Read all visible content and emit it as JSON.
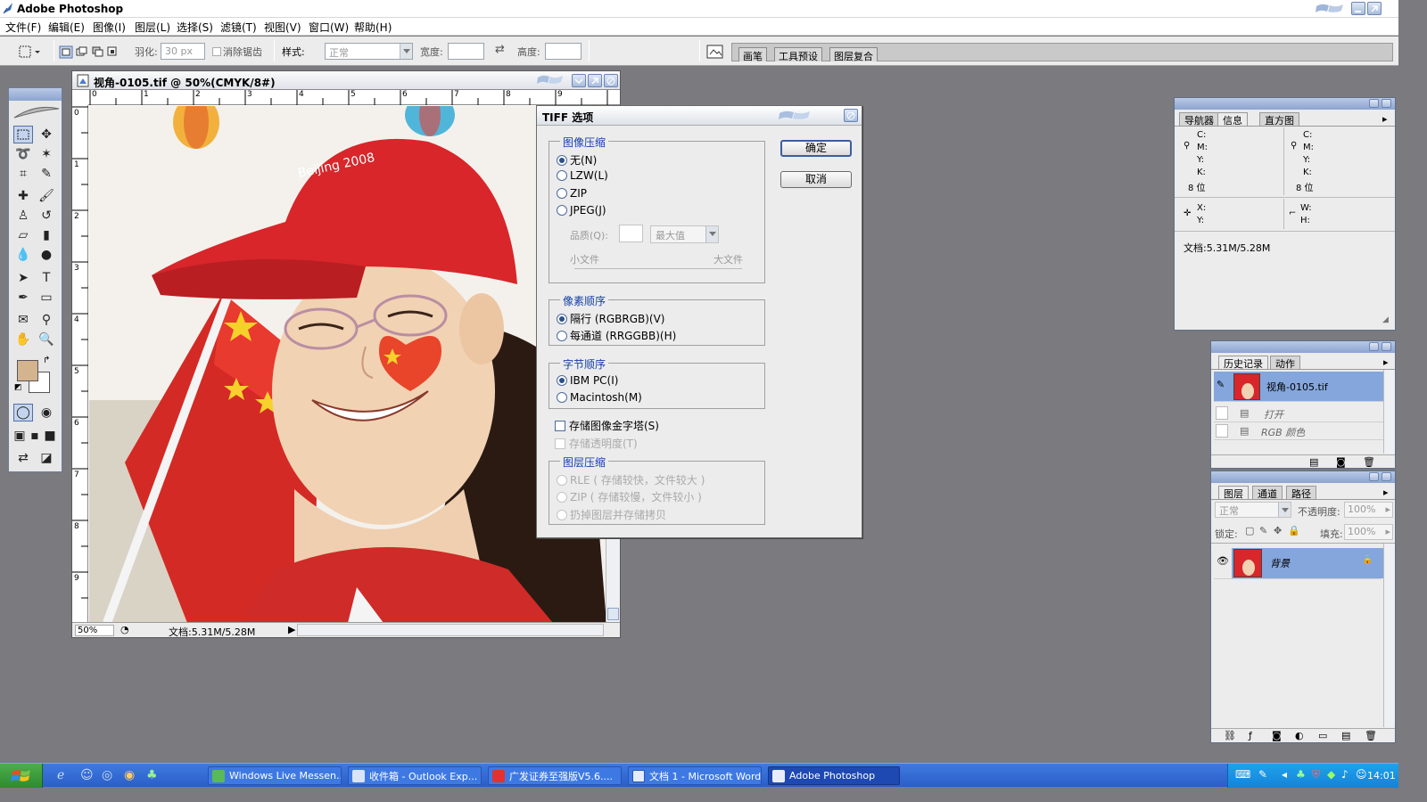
{
  "app": {
    "title": "Adobe Photoshop"
  },
  "menu": [
    "文件(F)",
    "编辑(E)",
    "图像(I)",
    "图层(L)",
    "选择(S)",
    "滤镜(T)",
    "视图(V)",
    "窗口(W)",
    "帮助(H)"
  ],
  "options_bar": {
    "feather_label": "羽化:",
    "feather_value": "30 px",
    "antialias_label": "消除锯齿",
    "style_label": "样式:",
    "style_value": "正常",
    "width_label": "宽度:",
    "height_label": "高度:",
    "well_tabs": [
      "画笔",
      "工具预设",
      "图层复合"
    ]
  },
  "document": {
    "title": "视角-0105.tif @ 50%(CMYK/8#)",
    "zoom": "50%",
    "doc_size": "文档:5.31M/5.28M",
    "ruler_h": [
      "0",
      "1",
      "2",
      "3",
      "4",
      "5",
      "6",
      "7",
      "8",
      "9"
    ],
    "ruler_v": [
      "0",
      "1",
      "2",
      "3",
      "4",
      "5",
      "6",
      "7",
      "8",
      "9"
    ]
  },
  "tiff_dialog": {
    "title": "TIFF 选项",
    "ok": "确定",
    "cancel": "取消",
    "image_compression": {
      "legend": "图像压缩",
      "options": [
        "无(N)",
        "LZW(L)",
        "ZIP",
        "JPEG(J)"
      ],
      "selected": 0,
      "quality_label": "品质(Q):",
      "quality_value": "最大值",
      "small_file": "小文件",
      "large_file": "大文件"
    },
    "pixel_order": {
      "legend": "像素顺序",
      "options": [
        "隔行 (RGBRGB)(V)",
        "每通道 (RRGGBB)(H)"
      ],
      "selected": 0
    },
    "byte_order": {
      "legend": "字节顺序",
      "options": [
        "IBM PC(I)",
        "Macintosh(M)"
      ],
      "selected": 0
    },
    "save_pyramid": "存储图像金字塔(S)",
    "save_transparency": "存储透明度(T)",
    "layer_compression": {
      "legend": "图层压缩",
      "options": [
        "RLE ( 存储较快，文件较大 )",
        "ZIP ( 存储较慢，文件较小 )",
        "扔掉图层并存储拷贝"
      ]
    }
  },
  "info_panel": {
    "tabs": [
      "导航器",
      "信息",
      "直方图"
    ],
    "active_tab": 1,
    "left_channels": [
      "C:",
      "M:",
      "Y:",
      "K:"
    ],
    "right_channels": [
      "C:",
      "M:",
      "Y:",
      "K:"
    ],
    "bit_depth": "8 位",
    "x_label": "X:",
    "y_label": "Y:",
    "w_label": "W:",
    "h_label": "H:",
    "doc_size": "文档:5.31M/5.28M"
  },
  "history_panel": {
    "tabs": [
      "历史记录",
      "动作"
    ],
    "snapshot": "视角-0105.tif",
    "steps": [
      "打开",
      "RGB 颜色"
    ]
  },
  "layers_panel": {
    "tabs": [
      "图层",
      "通道",
      "路径"
    ],
    "blend_mode": "正常",
    "opacity_label": "不透明度:",
    "opacity_value": "100%",
    "lock_label": "锁定:",
    "fill_label": "填充:",
    "fill_value": "100%",
    "layer_name": "背景"
  },
  "taskbar": {
    "items": [
      "Windows Live Messen...",
      "收件箱 - Outlook Exp...",
      "广发证券至强版V5.6....",
      "文档 1 - Microsoft Word",
      "Adobe Photoshop"
    ],
    "active": 4,
    "clock": "14:01"
  },
  "colors": {
    "foreground": "#d4b38f",
    "background": "#ffffff",
    "selection": "#84a6dc",
    "taskbar": "#2a5ec8"
  }
}
